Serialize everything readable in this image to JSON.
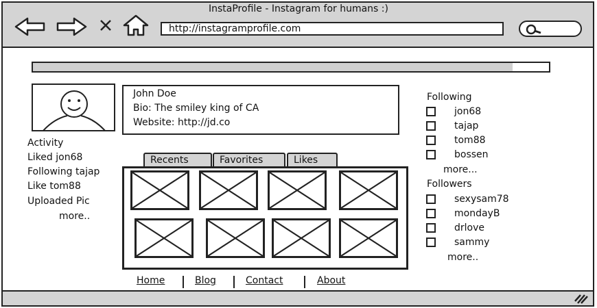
{
  "window": {
    "title": "InstaProfile - Instagram for humans :)"
  },
  "toolbar": {
    "url": "http://instagramprofile.com"
  },
  "progress": {
    "value": 0.93
  },
  "profile": {
    "name": "John Doe",
    "bio": "Bio: The smiley king of CA",
    "website": "Website: http://jd.co"
  },
  "activity": {
    "heading": "Activity",
    "items": [
      "Liked jon68",
      "Following tajap",
      "Like tom88",
      "Uploaded Pic"
    ],
    "more": "more.."
  },
  "tabs": [
    "Recents",
    "Favorites",
    "Likes"
  ],
  "following": {
    "heading": "Following",
    "users": [
      "jon68",
      "tajap",
      "tom88",
      "bossen"
    ],
    "more": "more..."
  },
  "followers": {
    "heading": "Followers",
    "users": [
      "sexysam78",
      "mondayB",
      "drlove",
      "sammy"
    ],
    "more": "more.."
  },
  "footer": {
    "links": [
      "Home",
      "Blog",
      "Contact",
      "About"
    ]
  },
  "icons": [
    "back-arrow-icon",
    "forward-arrow-icon",
    "close-icon",
    "home-icon",
    "search-icon",
    "resize-grip-icon"
  ]
}
